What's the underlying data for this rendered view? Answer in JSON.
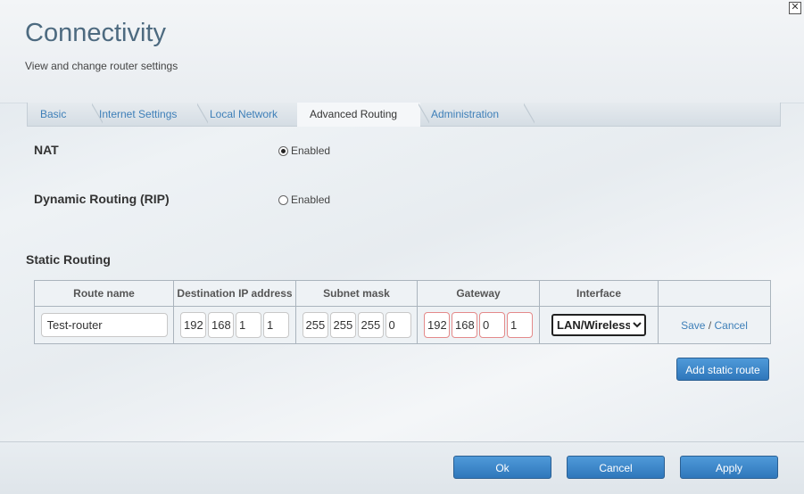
{
  "header": {
    "title": "Connectivity",
    "subtitle": "View and change router settings",
    "close_icon": "close-icon"
  },
  "tabs": [
    {
      "label": "Basic"
    },
    {
      "label": "Internet Settings"
    },
    {
      "label": "Local Network"
    },
    {
      "label": "Advanced Routing",
      "active": true
    },
    {
      "label": "Administration"
    }
  ],
  "nat": {
    "label": "NAT",
    "option": "Enabled",
    "checked": true
  },
  "rip": {
    "label": "Dynamic Routing (RIP)",
    "option": "Enabled",
    "checked": false
  },
  "static_routing": {
    "label": "Static Routing",
    "columns": [
      "Route name",
      "Destination IP address",
      "Subnet mask",
      "Gateway",
      "Interface",
      ""
    ],
    "row": {
      "route_name": "Test-router",
      "destination": [
        "192",
        "168",
        "1",
        "1"
      ],
      "subnet": [
        "255",
        "255",
        "255",
        "0"
      ],
      "gateway": [
        "192",
        "168",
        "0",
        "1"
      ],
      "interface": "LAN/Wireless",
      "save": "Save",
      "separator": "/",
      "cancel": "Cancel"
    },
    "add_button": "Add static route"
  },
  "footer": {
    "ok": "Ok",
    "cancel": "Cancel",
    "apply": "Apply"
  },
  "colors": {
    "accent": "#3e7fb8",
    "button": "#3b86c8",
    "error_border": "#e48a8a"
  }
}
